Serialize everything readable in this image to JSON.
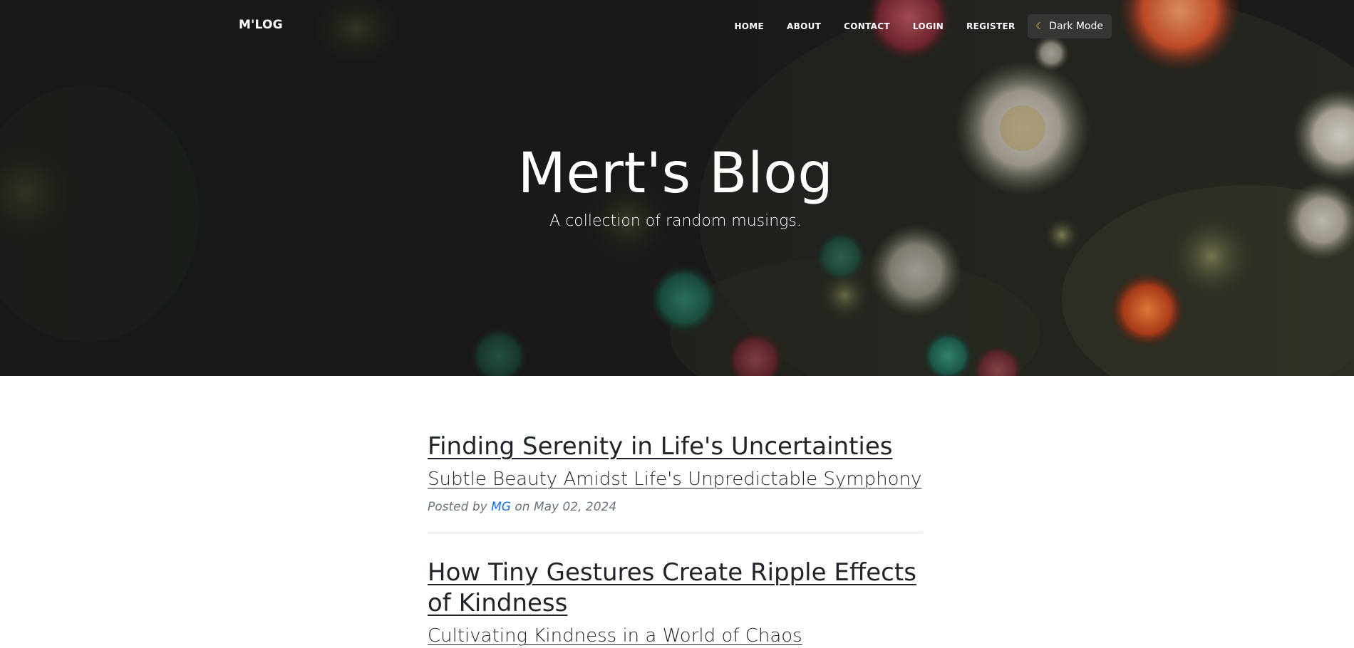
{
  "nav": {
    "brand": "M'LOG",
    "links": [
      "HOME",
      "ABOUT",
      "CONTACT",
      "LOGIN",
      "REGISTER"
    ],
    "dark_mode_icon": "moon-icon",
    "dark_mode_label": "Dark Mode"
  },
  "hero": {
    "title": "Mert's Blog",
    "subtitle": "A collection of random musings."
  },
  "posts": [
    {
      "title": "Finding Serenity in Life's Uncertainties",
      "subtitle": "Subtle Beauty Amidst Life's Unpredictable Symphony",
      "meta_prefix": "Posted by",
      "author": "MG",
      "meta_on": "on",
      "date": "May 02, 2024"
    },
    {
      "title": "How Tiny Gestures Create Ripple Effects of Kindness",
      "subtitle": "Cultivating Kindness in a World of Chaos"
    }
  ],
  "colors": {
    "link": "#0d6efd",
    "text": "#212529",
    "muted": "#6c757d",
    "accent_moon": "#f5c542"
  }
}
